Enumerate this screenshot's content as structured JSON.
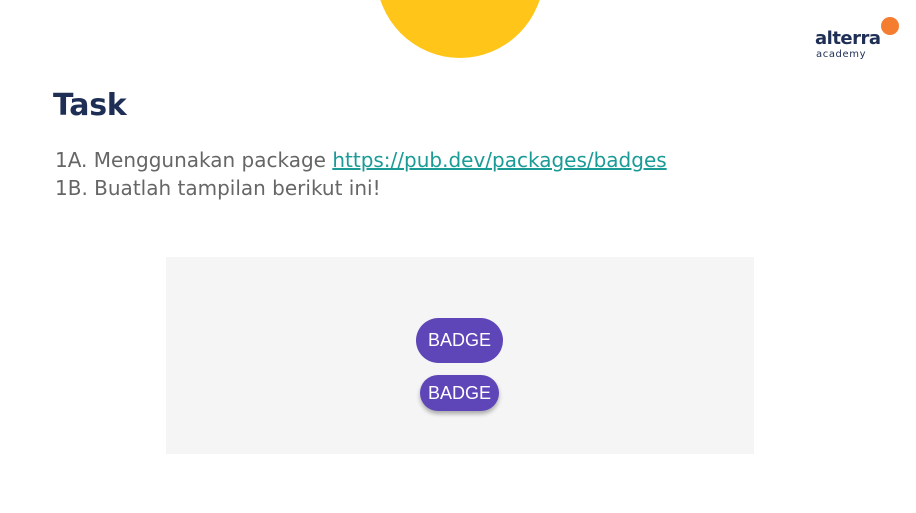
{
  "colors": {
    "accent_yellow": "#FFC518",
    "brand_orange": "#F47D30",
    "brand_navy": "#1E2E55",
    "link_teal": "#1A9B96",
    "badge_purple": "#5E45B8",
    "panel_bg": "#F5F5F5",
    "body_text": "#666666"
  },
  "logo": {
    "name": "alterra",
    "subtitle": "academy"
  },
  "title": "Task",
  "tasks": [
    {
      "text": "1A. Menggunakan package ",
      "link": "https://pub.dev/packages/badges"
    },
    {
      "text": "1B. Buatlah tampilan berikut ini!"
    }
  ],
  "preview": {
    "badges": [
      {
        "label": "BADGE"
      },
      {
        "label": "BADGE"
      }
    ]
  }
}
